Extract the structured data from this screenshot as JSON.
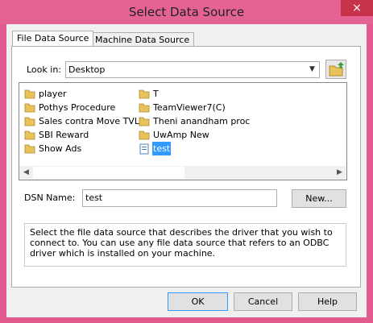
{
  "window": {
    "title": "Select Data Source",
    "close_glyph": "×"
  },
  "tabs": [
    {
      "label": "File Data Source",
      "active": true
    },
    {
      "label": "Machine Data Source",
      "active": false
    }
  ],
  "look_in": {
    "label": "Look in:",
    "value": "Desktop",
    "up_icon": "up-folder-icon"
  },
  "file_list": {
    "left_column": [
      "player",
      "Pothys Procedure",
      "Sales contra Move TVL",
      "SBI Reward",
      "Show Ads"
    ],
    "right_column": [
      "T",
      "TeamViewer7(C)",
      "Theni anandham proc",
      "UwAmp New",
      "test"
    ],
    "selected": "test"
  },
  "dsn": {
    "label": "DSN Name:",
    "value": "test",
    "new_button": "New..."
  },
  "description": "Select the file data source that describes the driver that you wish to connect to. You can use any file data source that refers to an ODBC driver which is installed on your machine.",
  "buttons": {
    "ok": "OK",
    "cancel": "Cancel",
    "help": "Help"
  },
  "colors": {
    "window_frame": "#e15b8f",
    "close_button": "#c7344a",
    "selection": "#3399ff",
    "folder": "#e8c25a"
  }
}
